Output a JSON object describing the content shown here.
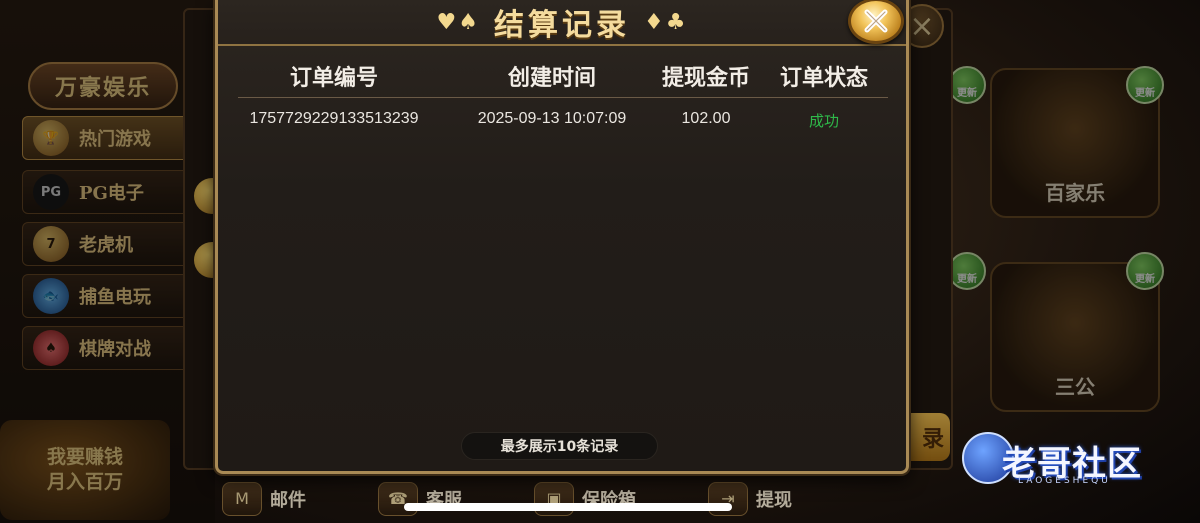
{
  "left_menu": {
    "brand": "万豪娱乐",
    "items": [
      {
        "label": "热门游戏",
        "icon": "trophy-icon",
        "icon_text": "",
        "active": true
      },
      {
        "label": "PG电子",
        "icon": "pg-logo-icon",
        "icon_text": "PG",
        "active": false
      },
      {
        "label": "老虎机",
        "icon": "slot-machine-icon",
        "icon_text": "",
        "active": false
      },
      {
        "label": "捕鱼电玩",
        "icon": "fish-icon",
        "icon_text": "",
        "active": false
      },
      {
        "label": "棋牌对战",
        "icon": "cards-icon",
        "icon_text": "",
        "active": false
      }
    ],
    "promo": {
      "line1": "我要赚钱",
      "line2": "月入百万"
    }
  },
  "right_games": [
    {
      "name": "百家乐",
      "update_label": "更新"
    },
    {
      "name": "三公",
      "update_label": "更新"
    }
  ],
  "watermark": {
    "text": "老哥社区",
    "subtext": "LAOGESHEQU"
  },
  "background_button": {
    "text": "录"
  },
  "bottom_nav": [
    {
      "label": "邮件",
      "icon": "mail-icon",
      "glyph": "M"
    },
    {
      "label": "客服",
      "icon": "headset-icon",
      "glyph": "☎"
    },
    {
      "label": "保险箱",
      "icon": "safe-icon",
      "glyph": "▣"
    },
    {
      "label": "提现",
      "icon": "withdraw-icon",
      "glyph": "⇥"
    }
  ],
  "dialog": {
    "title": "结算记录",
    "deco_left": "♥♠",
    "deco_right": "♦♣",
    "columns": [
      "订单编号",
      "创建时间",
      "提现金币",
      "订单状态"
    ],
    "rows": [
      {
        "order_id": "1757729229133513239",
        "created_at": "2025-09-13 10:07:09",
        "amount": "102.00",
        "status": "成功"
      }
    ],
    "footer_note": "最多展示10条记录"
  },
  "colors": {
    "title_gold": "#f5dc9e",
    "status_success": "#2fb94a",
    "border_gold": "#a98a55"
  }
}
